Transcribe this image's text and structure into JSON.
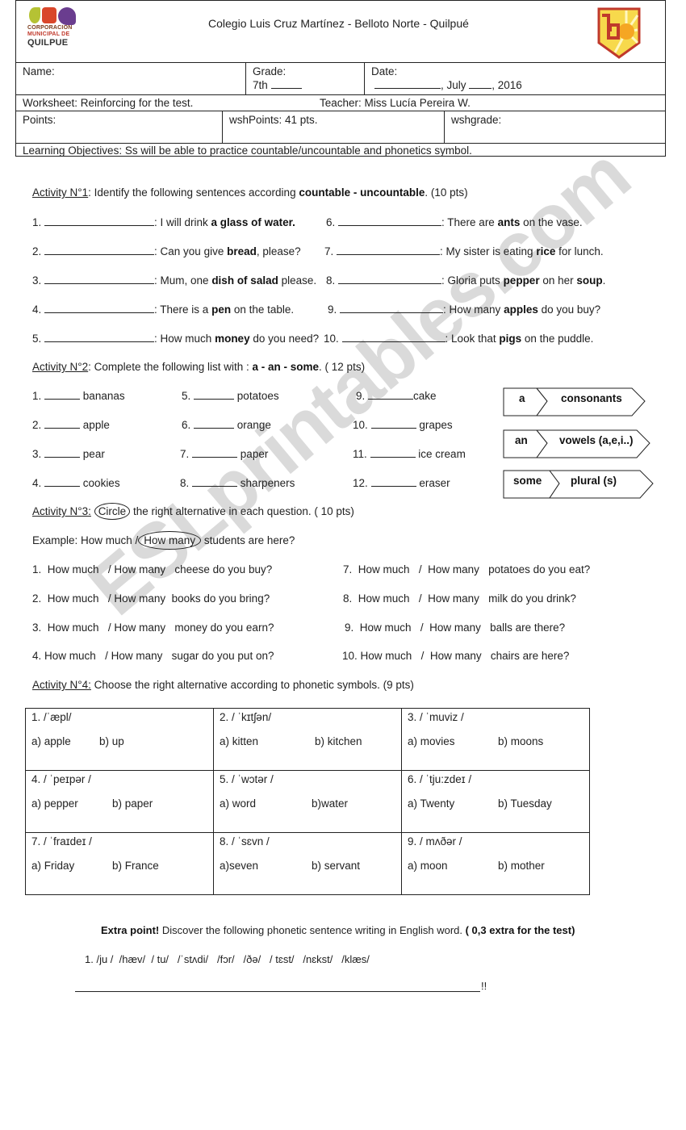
{
  "header": {
    "school_line": "Colegio Luis Cruz Martínez  -  Belloto Norte  -  Quilpué",
    "logo_left": {
      "line1": "CORPORACION",
      "line2": "MUNICIPAL DE",
      "line3": "QUILPUE"
    },
    "logo_right": {
      "icon": "school-shield-logo",
      "colors": [
        "#c0392b",
        "#f5a623",
        "#f7d94c"
      ]
    },
    "name_label": "Name:",
    "grade_label": "Grade:",
    "grade_value": "7th",
    "date_label": "Date:",
    "date_month": ", July",
    "date_year": ", 2016",
    "worksheet": "Worksheet: Reinforcing for the test.",
    "teacher": "Teacher: Miss Lucía Pereira W.",
    "points_label": "Points:",
    "wsh_points": "wshPoints: 41 pts.",
    "wsh_grade": "wshgrade:",
    "objectives": "Learning Objectives: Ss will be able to practice countable/uncountable and phonetics symbol."
  },
  "activity1": {
    "title": "Activity N°1",
    "instruction_pre": ": Identify the following sentences according ",
    "instruction_bold": "countable - uncountable",
    "instruction_post": ". (10 pts)",
    "items": [
      {
        "num": "1.",
        "pre": ": I will drink ",
        "bold": "a glass of water.",
        "post": ""
      },
      {
        "num": "2.",
        "pre": ": Can you give ",
        "bold": "bread",
        "post": ", please?"
      },
      {
        "num": "3.",
        "pre": ": Mum, one ",
        "bold": "dish of salad",
        "post": " please."
      },
      {
        "num": "4.",
        "pre": ": There is a ",
        "bold": "pen",
        "post": " on the table."
      },
      {
        "num": "5.",
        "pre": ": How much ",
        "bold": "money",
        "post": " do you need?"
      },
      {
        "num": "6.",
        "pre": ": There are ",
        "bold": "ants",
        "post": " on the vase."
      },
      {
        "num": "7.",
        "pre": ": My sister is eating ",
        "bold": "rice",
        "post": " for lunch."
      },
      {
        "num": "8.",
        "pre": ": Gloria puts ",
        "bold": "pepper",
        "post": " on her ",
        "bold2": "soup",
        "post2": "."
      },
      {
        "num": "9.",
        "pre": ": How many ",
        "bold": "apples",
        "post": " do you buy?"
      },
      {
        "num": "10.",
        "pre": ": Look that ",
        "bold": "pigs",
        "post": " on the puddle."
      }
    ]
  },
  "activity2": {
    "title": "Activity N°2",
    "instruction_pre": ": Complete the following list with : ",
    "instruction_bold": "a -   an -  some",
    "instruction_post": ". ( 12 pts)",
    "items": [
      {
        "num": "1.",
        "word": "bananas"
      },
      {
        "num": "2.",
        "word": "apple"
      },
      {
        "num": "3.",
        "word": "pear"
      },
      {
        "num": "4.",
        "word": "cookies"
      },
      {
        "num": "5.",
        "word": "potatoes"
      },
      {
        "num": "6.",
        "word": "orange"
      },
      {
        "num": "7.",
        "word": "paper"
      },
      {
        "num": "8.",
        "word": "sharpeners"
      },
      {
        "num": "9.",
        "word": "cake"
      },
      {
        "num": "10.",
        "word": "grapes"
      },
      {
        "num": "11.",
        "word": "ice cream"
      },
      {
        "num": "12.",
        "word": "eraser"
      }
    ],
    "rules": [
      {
        "article": "a",
        "use": "consonants"
      },
      {
        "article": "an",
        "use": "vowels (a,e,i..)"
      },
      {
        "article": "some",
        "use": "plural  (s)"
      }
    ]
  },
  "activity3": {
    "title": "Activity N°3:",
    "circle_word": "Circle",
    "instruction_post": " the right alternative in each question. ( 10 pts)",
    "example_label": "Example:   How  much  /",
    "example_circled": "How many",
    "example_post": " students are here?",
    "option_a": "How much",
    "option_b": "How many",
    "items": [
      {
        "num": "1.",
        "rest": "cheese do you buy?"
      },
      {
        "num": "2.",
        "rest": "books do you bring?"
      },
      {
        "num": "3.",
        "rest": "money do you earn?"
      },
      {
        "num": "4.",
        "rest": "sugar do you put on?"
      },
      {
        "num": "7.",
        "rest": "potatoes do you eat?"
      },
      {
        "num": "8.",
        "rest": "milk do you drink?"
      },
      {
        "num": "9.",
        "rest": "balls are there?"
      },
      {
        "num": "10.",
        "rest": "chairs are here?"
      }
    ]
  },
  "activity4": {
    "title": "Activity N°4:",
    "instruction": "  Choose the right alternative according to phonetic symbols. (9 pts)",
    "cells": [
      {
        "q": "1. /ˈæpl/",
        "a": "a) apple",
        "b": "b) up"
      },
      {
        "q": "2. / ˈkɪtʃən/",
        "a": "a) kitten",
        "b": "b) kitchen"
      },
      {
        "q": "3. / ˈmuviz /",
        "a": "a) movies",
        "b": "b) moons"
      },
      {
        "q": "4. / ˈpeɪpər /",
        "a": "a) pepper",
        "b": "b) paper"
      },
      {
        "q": "5. / ˈwɔtər /",
        "a": "a) word",
        "b": "b)water"
      },
      {
        "q": "6. / ˈtju:zdeɪ /",
        "a": "a) Twenty",
        "b": "b) Tuesday"
      },
      {
        "q": "7. / ˈfraɪdeɪ /",
        "a": "a) Friday",
        "b": "b) France"
      },
      {
        "q": "8. / ˈsɛvn /",
        "a": "a)seven",
        "b": "b) servant"
      },
      {
        "q": "9. / mʌðər /",
        "a": "a) moon",
        "b": "b) mother"
      }
    ]
  },
  "extra": {
    "bold_pre": "Extra point!",
    "text": " Discover the following phonetic sentence writing in English word. ",
    "bold_post": "( 0,3 extra for the test)",
    "sentence": "1. /ju /  /hæv/  / tu/   /ˈstʌdi/   /fɔr/   /ðə/   / tɛst/   /nɛkst/   /klæs/",
    "end_mark": "!!"
  },
  "watermark": "ESLprintables.com"
}
